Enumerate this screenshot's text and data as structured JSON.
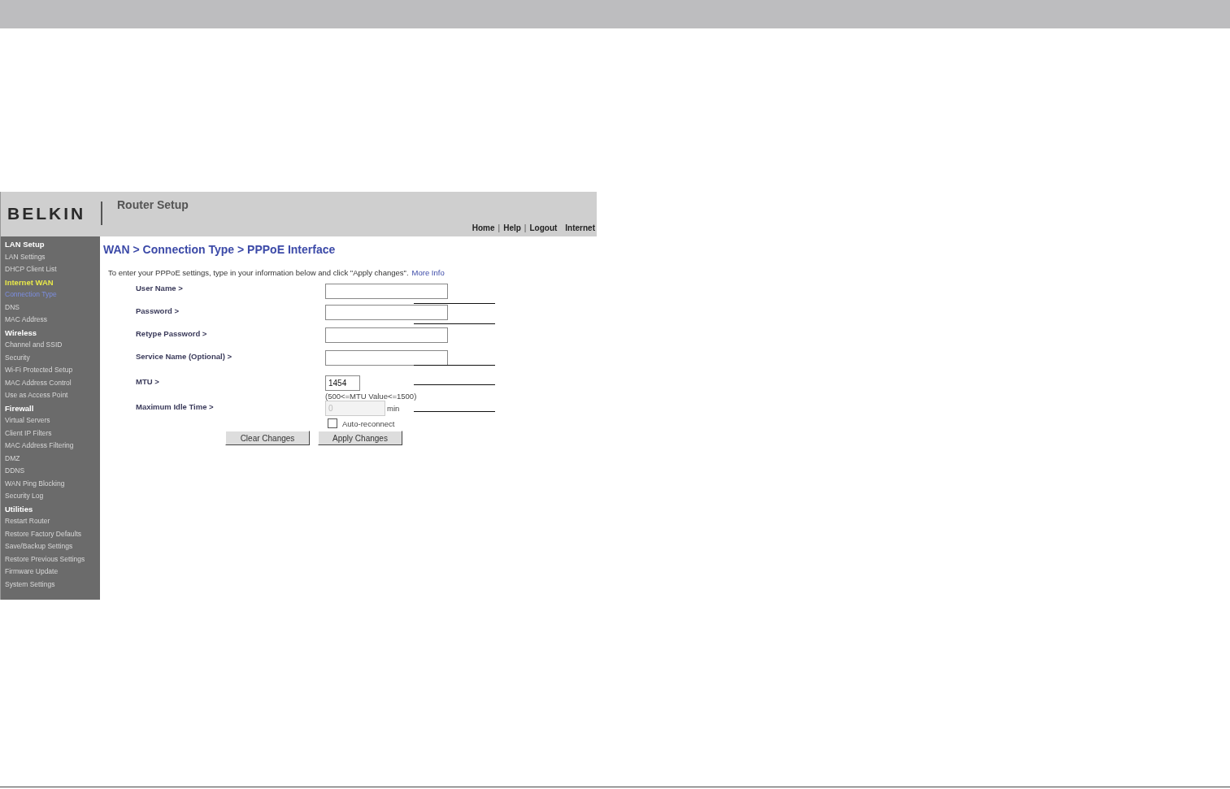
{
  "header": {
    "logo": "BELKIN",
    "title": "Router Setup",
    "links": [
      {
        "kind": "link",
        "text": "Home"
      },
      {
        "kind": "separator",
        "text": "|"
      },
      {
        "kind": "link",
        "text": "Help"
      },
      {
        "kind": "separator",
        "text": "|"
      },
      {
        "kind": "link",
        "text": "Logout"
      }
    ],
    "status": "Internet"
  },
  "sidebar": [
    {
      "title": "LAN Setup",
      "selected": false,
      "items": [
        {
          "label": "LAN Settings",
          "selected": false
        },
        {
          "label": "DHCP Client List",
          "selected": false
        }
      ]
    },
    {
      "title": "Internet WAN",
      "selected": true,
      "items": [
        {
          "label": "Connection Type",
          "selected": true
        },
        {
          "label": "DNS",
          "selected": false
        },
        {
          "label": "MAC Address",
          "selected": false
        }
      ]
    },
    {
      "title": "Wireless",
      "selected": false,
      "items": [
        {
          "label": "Channel and SSID",
          "selected": false
        },
        {
          "label": "Security",
          "selected": false
        },
        {
          "label": "Wi-Fi Protected Setup",
          "selected": false
        },
        {
          "label": "MAC Address Control",
          "selected": false
        },
        {
          "label": "Use as Access Point",
          "selected": false
        }
      ]
    },
    {
      "title": "Firewall",
      "selected": false,
      "items": [
        {
          "label": "Virtual Servers",
          "selected": false
        },
        {
          "label": "Client IP Filters",
          "selected": false
        },
        {
          "label": "MAC Address Filtering",
          "selected": false
        },
        {
          "label": "DMZ",
          "selected": false
        },
        {
          "label": "DDNS",
          "selected": false
        },
        {
          "label": "WAN Ping Blocking",
          "selected": false
        },
        {
          "label": "Security Log",
          "selected": false
        }
      ]
    },
    {
      "title": "Utilities",
      "selected": false,
      "items": [
        {
          "label": "Restart Router",
          "selected": false
        },
        {
          "label": "Restore Factory Defaults",
          "selected": false
        },
        {
          "label": "Save/Backup Settings",
          "selected": false
        },
        {
          "label": "Restore Previous Settings",
          "selected": false
        },
        {
          "label": "Firmware Update",
          "selected": false
        },
        {
          "label": "System Settings",
          "selected": false
        }
      ]
    }
  ],
  "page_title": "WAN > Connection Type > PPPoE Interface",
  "intro": "To enter your PPPoE settings, type in your information below and click \"Apply changes\".",
  "more_info": "More Info",
  "fields": [
    {
      "label": "User Name >",
      "kind": "text",
      "disabled": false,
      "leader": true
    },
    {
      "label": "Password >",
      "kind": "text",
      "disabled": false,
      "leader": true
    },
    {
      "label": "Retype Password >",
      "kind": "text",
      "disabled": false,
      "leader": false
    },
    {
      "label": "Service Name (Optional) >",
      "kind": "text",
      "disabled": false,
      "leader": true
    },
    {
      "label": "MTU >",
      "kind": "short",
      "value": "1454",
      "hint": "(500<=MTU Value<=1500)",
      "disabled": false,
      "leader": true
    },
    {
      "label": "Maximum Idle Time >",
      "kind": "idle",
      "value": "0",
      "unit": "min",
      "disabled": true,
      "leader": true
    }
  ],
  "auto_reconnect": {
    "label": "Auto-reconnect",
    "checked": false
  },
  "buttons": [
    "Clear Changes",
    "Apply Changes"
  ]
}
